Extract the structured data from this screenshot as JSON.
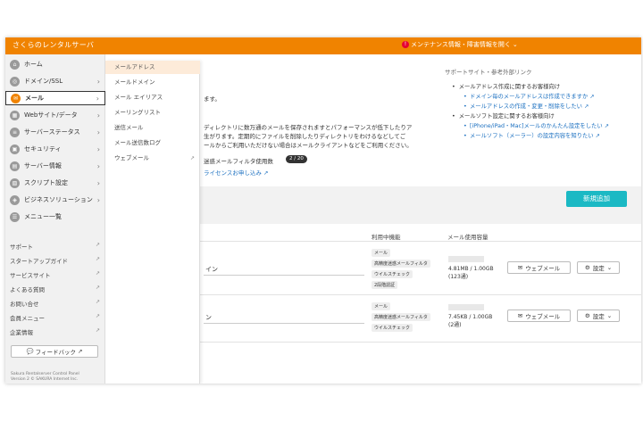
{
  "header": {
    "brand": "さくらのレンタルサーバ",
    "notice": "メンテナンス情報・障害情報を開く",
    "notice_chevron": "⌄"
  },
  "sidebar": {
    "items": [
      {
        "label": "ホーム",
        "icon": "home-icon",
        "has_chevron": false
      },
      {
        "label": "ドメイン/SSL",
        "icon": "globe-icon",
        "has_chevron": true
      },
      {
        "label": "メール",
        "icon": "mail-icon",
        "has_chevron": true,
        "active": true
      },
      {
        "label": "Webサイト/データ",
        "icon": "web-icon",
        "has_chevron": true
      },
      {
        "label": "サーバーステータス",
        "icon": "server-status-icon",
        "has_chevron": true
      },
      {
        "label": "セキュリティ",
        "icon": "lock-icon",
        "has_chevron": true
      },
      {
        "label": "サーバー情報",
        "icon": "server-info-icon",
        "has_chevron": true
      },
      {
        "label": "スクリプト設定",
        "icon": "script-icon",
        "has_chevron": true
      },
      {
        "label": "ビジネスソリューション",
        "icon": "business-icon",
        "has_chevron": true
      },
      {
        "label": "メニュー一覧",
        "icon": "menu-list-icon",
        "has_chevron": false
      }
    ],
    "sub_links": [
      {
        "label": "サポート"
      },
      {
        "label": "スタートアップガイド"
      },
      {
        "label": "サービスサイト"
      },
      {
        "label": "よくある質問"
      },
      {
        "label": "お問い合せ"
      },
      {
        "label": "会員メニュー"
      },
      {
        "label": "企業情報"
      }
    ],
    "feedback": "フィードバック",
    "copyright_1": "Sakura Rentalserver Control Panel",
    "copyright_2": "Version 2  © SAKURA Internet Inc."
  },
  "dropdown": {
    "items": [
      {
        "label": "メールアドレス",
        "selected": true
      },
      {
        "label": "メールドメイン"
      },
      {
        "label": "メール エイリアス"
      },
      {
        "label": "メーリングリスト"
      },
      {
        "label": "送信メール"
      },
      {
        "label": "メール送信数ログ"
      },
      {
        "label": "ウェブメール",
        "external": true
      }
    ]
  },
  "main": {
    "frag_1": "ます。",
    "frag_2": "ディレクトリに数万通のメールを保存されますとパフォーマンスが低下したりア",
    "frag_3": "生がります。定期的にファイルを削除したりディレクトリをわけるなどしてご",
    "frag_4": "ールからご利用いただけない場合はメールクライアントなどをご利用ください。",
    "filter_label": "迷惑メールフィルタ使用数",
    "filter_count": "2 / 20",
    "license_link": "ライセンスお申し込み",
    "support_links": {
      "heading": "サポートサイト・参考外部リンク",
      "section_1": "メールアドレス作成に関するお客様向け",
      "link_1": "ドメイン毎のメールアドレスは作成できますか",
      "link_2": "メールアドレスの作成・変更・削除をしたい",
      "section_2": "メールソフト設定に関するお客様向け",
      "link_3": "[iPhone/iPad・Mac]メールのかんたん設定をしたい",
      "link_4": "メールソフト（メーラー）の設定内容を知りたい"
    },
    "add_button": "新規追加",
    "col_features": "利用中機能",
    "col_usage": "メール使用容量",
    "rows": [
      {
        "name_fragment": "イン",
        "tags": [
          "メール",
          "高精度迷惑メールフィルタ",
          "ウイルスチェック",
          "2段階認証"
        ],
        "usage_1": "4.81MB / 1.00GB",
        "usage_2": "(123通)",
        "usage_fraction": 0.005,
        "webmail": "ウェブメール",
        "settings": "設定"
      },
      {
        "name_fragment": "ン",
        "tags": [
          "メール",
          "高精度迷惑メールフィルタ",
          "ウイルスチェック"
        ],
        "usage_1": "7.45KB / 1.00GB",
        "usage_2": "(2通)",
        "usage_fraction": 0.0001,
        "webmail": "ウェブメール",
        "settings": "設定"
      }
    ]
  },
  "colors": {
    "brand_orange": "#f08300",
    "accent_teal": "#1bb9c4",
    "link_blue": "#1a6fc0"
  }
}
